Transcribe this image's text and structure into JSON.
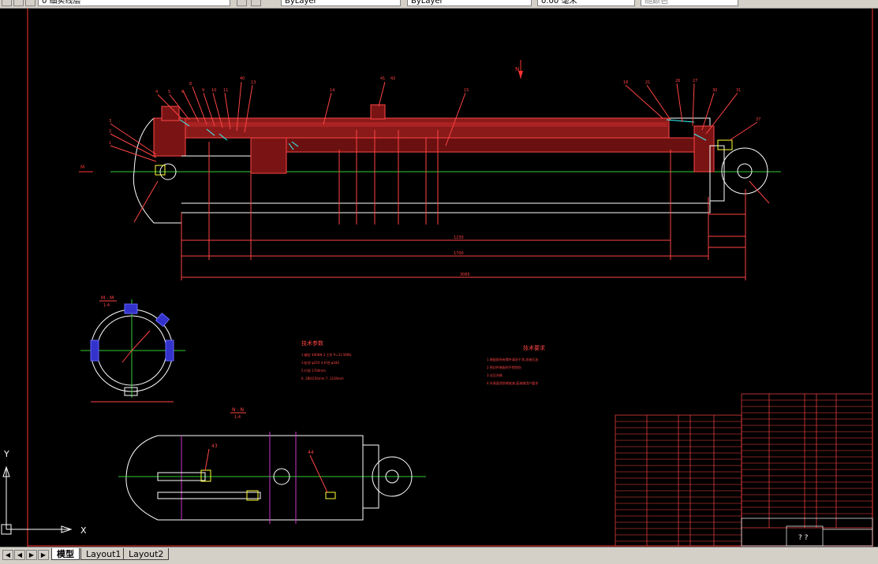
{
  "toolbar": {
    "layer_value": "0 细实线层",
    "linetype_value": "ByLayer",
    "linetype2_value": "ByLayer",
    "lineweight_value": "0.00 毫米",
    "plotstyle_value": "随颜色"
  },
  "drawing": {
    "north_label": "N",
    "section_left_label": "M",
    "section_view_label": "M - M",
    "section_view_scale": "1:4",
    "view_label": "N - N",
    "view_scale": "1:4",
    "part_callout_a": "43",
    "part_callout_b": "44",
    "part_callout_top_a": "41",
    "part_callout_top_b": "42",
    "part_callout_14": "14",
    "part_callout_15": "15",
    "tech_req_title": "技术要求",
    "tech_req_left": "技术参数",
    "dims": {
      "total": "3065",
      "stroke": "1700",
      "length_2": "1230"
    }
  },
  "ucs": {
    "x_label": "X",
    "y_label": "Y"
  },
  "tabs": {
    "model": "模型",
    "layout1": "Layout1",
    "layout2": "Layout2"
  },
  "title_block": {
    "title": "? ?"
  }
}
